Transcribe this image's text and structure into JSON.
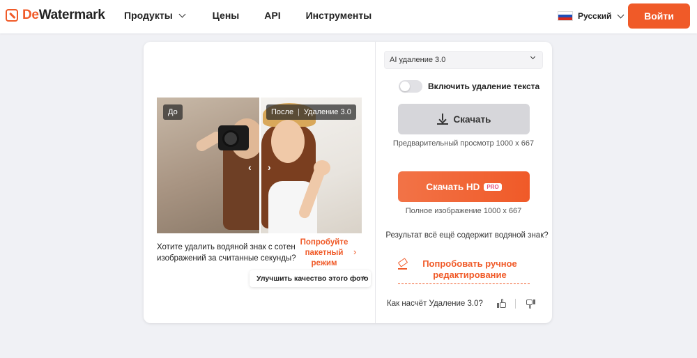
{
  "header": {
    "logo": {
      "accent": "De",
      "rest": "Watermark"
    },
    "nav": [
      {
        "label": "Продукты",
        "has_dropdown": true
      },
      {
        "label": "Цены"
      },
      {
        "label": "API"
      },
      {
        "label": "Инструменты"
      }
    ],
    "language": "Русский",
    "login_label": "Войти"
  },
  "preview": {
    "before_label": "До",
    "after_label": "После",
    "after_version": "Удаление 3.0",
    "batch_prompt": "Хотите удалить водяной знак с сотен изображений за считанные секунды?",
    "batch_link": "Попробуйте пакетный режим",
    "improve_button": "Улучшить качество этого фото"
  },
  "panel": {
    "model_select": "AI удаление 3.0",
    "text_removal_toggle": {
      "label": "Включить удаление текста",
      "enabled": false
    },
    "download_label": "Скачать",
    "preview_note": "Предварительный просмотр 1000 x 667",
    "download_hd_label": "Скачать HD",
    "pro_badge": "PRO",
    "full_note": "Полное изображение 1000 x 667",
    "still_watermark": "Результат всё ещё содержит водяной знак?",
    "manual_edit": "Попробовать ручное редактирование",
    "feedback_question": "Как насчёт Удаление 3.0?"
  },
  "colors": {
    "brand": "#f05a28",
    "background": "#f0f1f5",
    "pro_badge_text": "#e5507a"
  }
}
